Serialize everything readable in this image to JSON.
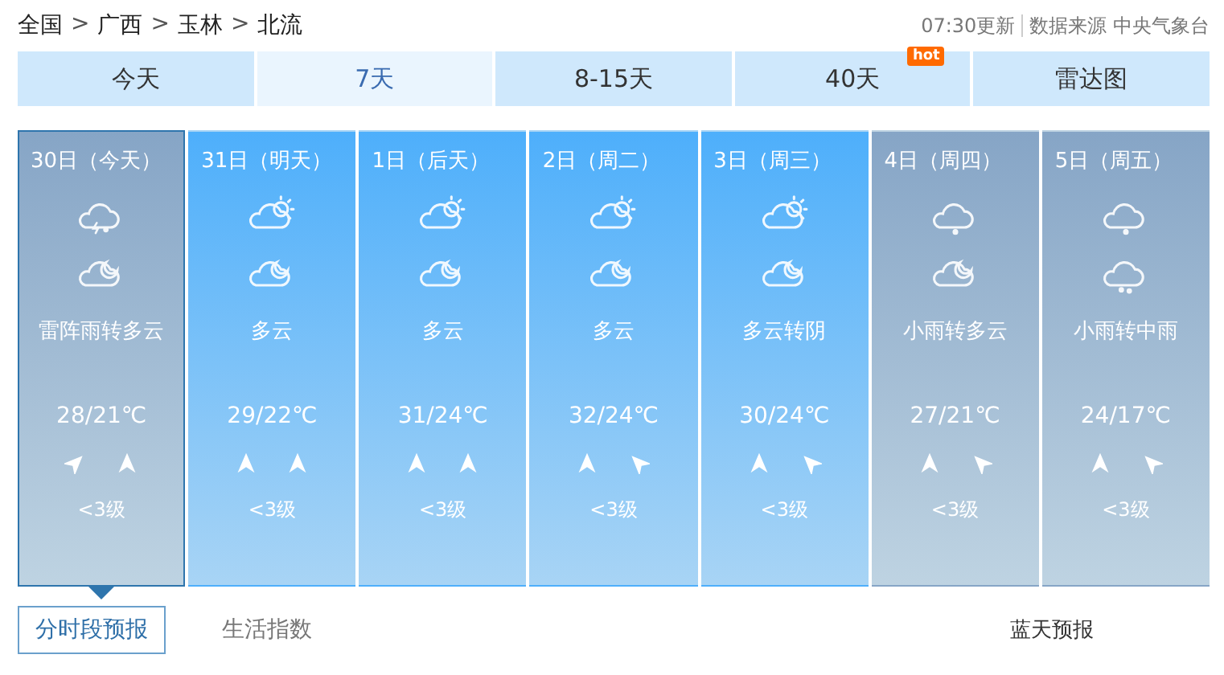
{
  "breadcrumb": [
    "全国",
    "广西",
    "玉林",
    "北流"
  ],
  "separator": ">",
  "update_time": "07:30更新",
  "source": "数据来源 中央气象台",
  "tabs": [
    {
      "label": "今天",
      "selected": false
    },
    {
      "label": "7天",
      "selected": true
    },
    {
      "label": "8-15天",
      "selected": false
    },
    {
      "label": "40天",
      "selected": false,
      "badge": "hot"
    },
    {
      "label": "雷达图",
      "selected": false
    }
  ],
  "days": [
    {
      "date": "30日（今天）",
      "kind": "rainy",
      "selected": true,
      "icons": [
        {
          "kind": "thunderstorm"
        },
        {
          "kind": "night"
        }
      ],
      "weather": "雷阵雨转多云",
      "temp": "28/21℃",
      "winds": [
        {
          "kind": "northeast"
        },
        {
          "kind": "north"
        }
      ],
      "level": "<3级"
    },
    {
      "date": "31日（明天）",
      "kind": "fair",
      "selected": false,
      "icons": [
        {
          "kind": "partlycloudy"
        },
        {
          "kind": "night"
        }
      ],
      "weather": "多云",
      "temp": "29/22℃",
      "winds": [
        {
          "kind": "north"
        },
        {
          "kind": "north"
        }
      ],
      "level": "<3级"
    },
    {
      "date": "1日（后天）",
      "kind": "fair",
      "selected": false,
      "icons": [
        {
          "kind": "partlycloudy"
        },
        {
          "kind": "night"
        }
      ],
      "weather": "多云",
      "temp": "31/24℃",
      "winds": [
        {
          "kind": "north"
        },
        {
          "kind": "north"
        }
      ],
      "level": "<3级"
    },
    {
      "date": "2日（周二）",
      "kind": "fair",
      "selected": false,
      "icons": [
        {
          "kind": "partlycloudy"
        },
        {
          "kind": "night"
        }
      ],
      "weather": "多云",
      "temp": "32/24℃",
      "winds": [
        {
          "kind": "north"
        },
        {
          "kind": "northwest"
        }
      ],
      "level": "<3级"
    },
    {
      "date": "3日（周三）",
      "kind": "fair",
      "selected": false,
      "icons": [
        {
          "kind": "partlycloudy"
        },
        {
          "kind": "night"
        }
      ],
      "weather": "多云转阴",
      "temp": "30/24℃",
      "winds": [
        {
          "kind": "north"
        },
        {
          "kind": "northwest"
        }
      ],
      "level": "<3级"
    },
    {
      "date": "4日（周四）",
      "kind": "rainy",
      "selected": false,
      "icons": [
        {
          "kind": "drizzle"
        },
        {
          "kind": "night"
        }
      ],
      "weather": "小雨转多云",
      "temp": "27/21℃",
      "winds": [
        {
          "kind": "north"
        },
        {
          "kind": "northwest"
        }
      ],
      "level": "<3级"
    },
    {
      "date": "5日（周五）",
      "kind": "rainy",
      "selected": false,
      "icons": [
        {
          "kind": "drizzle"
        },
        {
          "kind": "rain"
        }
      ],
      "weather": "小雨转中雨",
      "temp": "24/17℃",
      "winds": [
        {
          "kind": "north"
        },
        {
          "kind": "northwest"
        }
      ],
      "level": "<3级"
    }
  ],
  "sub_tabs": [
    {
      "label": "分时段预报",
      "selected": true
    },
    {
      "label": "生活指数",
      "selected": false
    }
  ],
  "side_link": "蓝天预报"
}
